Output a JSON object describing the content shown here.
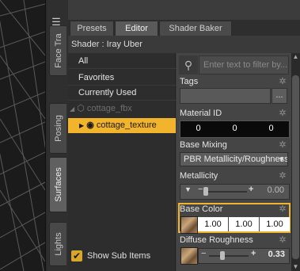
{
  "side_tabs": [
    "Face Tra",
    "Posing",
    "Surfaces",
    "Lights"
  ],
  "tabs": [
    "Presets",
    "Editor",
    "Shader Baker"
  ],
  "shader_label": "Shader : Iray Uber",
  "tree": {
    "items": [
      "All",
      "Favorites",
      "Currently Used"
    ],
    "node": "cottage_fbx",
    "selected": "cottage_texture"
  },
  "show_sub_items": "Show Sub Items",
  "search": {
    "placeholder": "Enter text to filter by..."
  },
  "tags": {
    "label": "Tags",
    "button": "..."
  },
  "material_id": {
    "label": "Material ID",
    "values": [
      "0",
      "0",
      "0"
    ]
  },
  "base_mixing": {
    "label": "Base Mixing",
    "value": "PBR Metallicity/Roughness"
  },
  "metallicity": {
    "label": "Metallicity",
    "value": "0.00",
    "level": 0.0
  },
  "base_color": {
    "label": "Base Color",
    "values": [
      "1.00",
      "1.00",
      "1.00"
    ]
  },
  "diffuse_roughness": {
    "label": "Diffuse Roughness",
    "value": "0.33",
    "level": 0.33
  },
  "colors": {
    "accent": "#f2b32d",
    "panel": "#454545",
    "tree": "#2d2d2d"
  }
}
